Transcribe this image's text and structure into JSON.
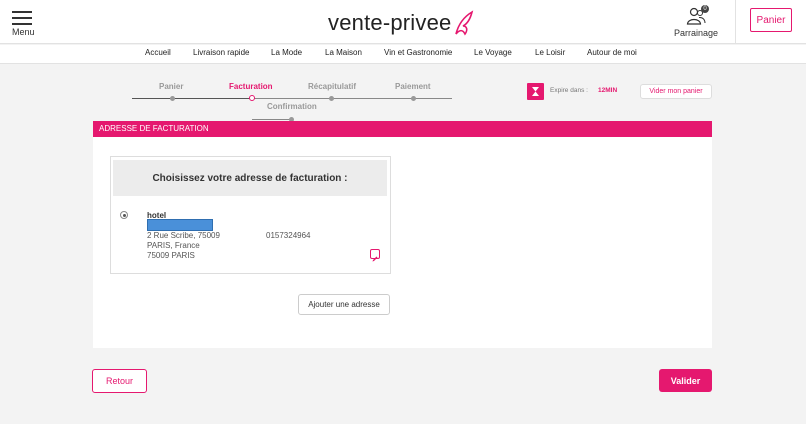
{
  "header": {
    "menu_label": "Menu",
    "logo_text": "vente-privee",
    "parrainage_label": "Parrainage",
    "parrainage_badge": "0",
    "panier_label": "Panier"
  },
  "nav": {
    "items": [
      "Accueil",
      "Livraison rapide",
      "La Mode",
      "La Maison",
      "Vin et Gastronomie",
      "Le Voyage",
      "Le Loisir",
      "Autour de moi"
    ]
  },
  "steps": {
    "items": [
      {
        "label": "Panier",
        "state": "done"
      },
      {
        "label": "Facturation",
        "state": "active"
      },
      {
        "label": "Récapitulatif",
        "state": "todo"
      },
      {
        "label": "Paiement",
        "state": "todo"
      },
      {
        "label": "Confirmation",
        "state": "todo"
      }
    ]
  },
  "timer": {
    "label": "Expire dans :",
    "value": "12MIN",
    "empty_cart_label": "Vider mon panier"
  },
  "section": {
    "title": "ADRESSE DE FACTURATION",
    "choose_title": "Choisissez votre adresse de facturation :"
  },
  "address": {
    "selected": true,
    "name": "hotel",
    "line1": "2 Rue Scribe, 75009",
    "line2": "PARIS, France",
    "line3": "75009 PARIS",
    "phone": "0157324964"
  },
  "actions": {
    "add_address_label": "Ajouter une adresse",
    "back_label": "Retour",
    "validate_label": "Valider"
  },
  "colors": {
    "accent": "#e5186f"
  }
}
